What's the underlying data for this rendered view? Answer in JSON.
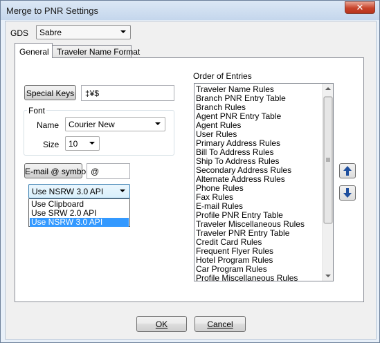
{
  "window": {
    "title": "Merge to PNR Settings",
    "close_glyph": "✕"
  },
  "gds": {
    "label": "GDS",
    "value": "Sabre"
  },
  "tabs": [
    {
      "label": "General",
      "active": true
    },
    {
      "label": "Traveler Name Format",
      "active": false
    }
  ],
  "general": {
    "special_keys_label": "Special Keys",
    "special_keys_value": "‡¥$",
    "font_group_label": "Font",
    "font_name_label": "Name",
    "font_name_value": "Courier New",
    "font_size_label": "Size",
    "font_size_value": "10",
    "email_symbol_label": "E-mail @ symbol",
    "email_symbol_value": "@",
    "api_selected": "Use NSRW 3.0 API",
    "api_options": [
      "Use Clipboard",
      "Use SRW 2.0 API",
      "Use NSRW 3.0 API"
    ],
    "api_highlighted_index": 2
  },
  "order_of_entries": {
    "label": "Order of Entries",
    "items": [
      "Traveler Name Rules",
      "Branch PNR Entry Table",
      "Branch Rules",
      "Agent PNR Entry Table",
      "Agent Rules",
      "User Rules",
      "Primary Address Rules",
      "Bill To Address Rules",
      "Ship To Address Rules",
      "Secondary Address Rules",
      "Alternate Address Rules",
      "Phone Rules",
      "Fax Rules",
      "E-mail Rules",
      "Profile PNR Entry Table",
      "Traveler Miscellaneous Rules",
      "Traveler PNR Entry Table",
      "Credit Card Rules",
      "Frequent Flyer Rules",
      "Hotel Program Rules",
      "Car Program Rules",
      "Profile Miscellaneous Rules"
    ],
    "move_up_icon": "arrow-up",
    "move_down_icon": "arrow-down"
  },
  "footer": {
    "ok_label": "OK",
    "cancel_label": "Cancel"
  },
  "colors": {
    "move_arrow": "#1f4f9e",
    "selection": "#3399ff"
  }
}
